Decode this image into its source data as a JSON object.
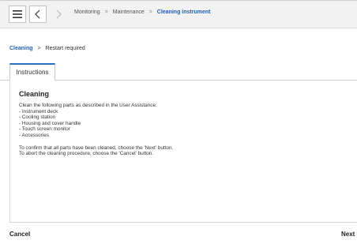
{
  "header": {
    "breadcrumb": [
      "Monitoring",
      "Maintenance",
      "Cleaning instrument"
    ],
    "separator": ">"
  },
  "steps": {
    "active": "Cleaning",
    "separator": ">",
    "next": "Restart required"
  },
  "tabs": [
    {
      "label": "Instructions"
    }
  ],
  "content": {
    "title": "Cleaning",
    "lines": [
      "Clean the following parts as described in the User Assistance:",
      "- Instrument deck",
      "- Cooling station",
      "- Housing and cover handle",
      "- Touch screen monitor",
      "- Accessories"
    ],
    "confirm": "To confirm that all parts have been cleaned, choose the 'Next' button.",
    "abort": "To abort the cleaning procedure, choose the 'Cancel' button."
  },
  "footer": {
    "cancel_label": "Cancel",
    "next_label": "Next"
  },
  "colors": {
    "accent": "#1f5fb5",
    "tab_border": "#2a6ebb"
  },
  "icons": {
    "menu": "hamburger-icon",
    "back": "chevron-left-icon",
    "forward": "chevron-right-icon"
  }
}
